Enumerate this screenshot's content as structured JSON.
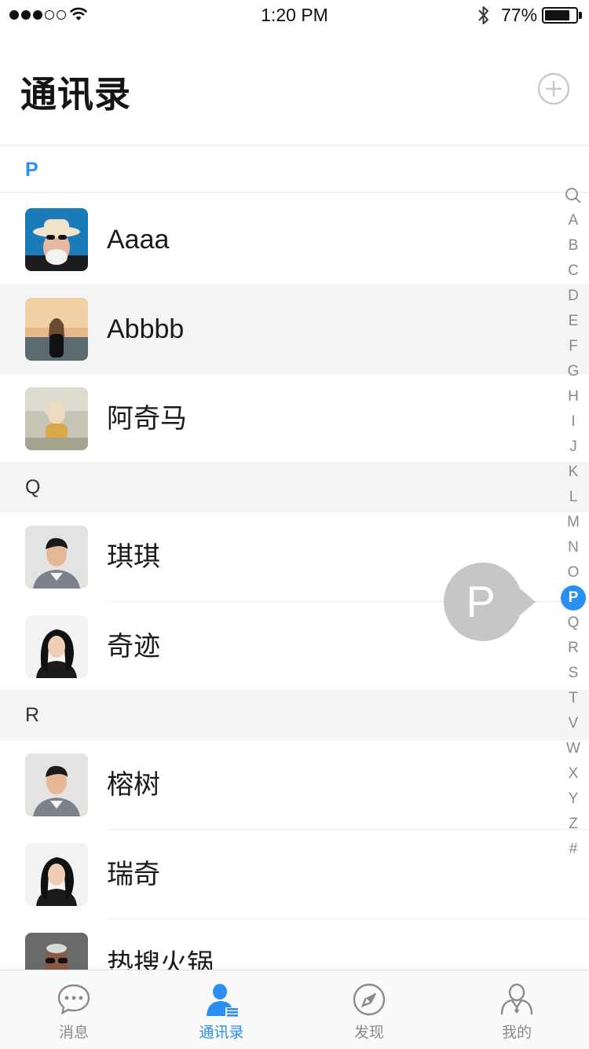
{
  "status_bar": {
    "time": "1:20 PM",
    "battery_percent": "77%",
    "signal_bars_filled": 3,
    "signal_bars_total": 5,
    "battery_level": 0.77
  },
  "header": {
    "title": "通讯录",
    "add_icon": "plus-circle-icon"
  },
  "sections": [
    {
      "letter": "P",
      "contacts": [
        "Aaaa",
        "Abbbb",
        "阿奇马"
      ]
    },
    {
      "letter": "Q",
      "contacts": [
        "琪琪",
        "奇迹"
      ]
    },
    {
      "letter": "R",
      "contacts": [
        "榕树",
        "瑞奇",
        "热搜火锅"
      ]
    }
  ],
  "highlighted_contact": "Abbbb",
  "index_bar": {
    "search_icon": "search-icon",
    "letters": [
      "A",
      "B",
      "C",
      "D",
      "E",
      "F",
      "G",
      "H",
      "I",
      "J",
      "K",
      "L",
      "M",
      "N",
      "O",
      "P",
      "Q",
      "R",
      "S",
      "T",
      "V",
      "W",
      "X",
      "Y",
      "Z",
      "#"
    ],
    "active": "P"
  },
  "index_bubble_letter": "P",
  "tab_bar": [
    {
      "label": "消息",
      "icon": "chat-bubble-icon",
      "active": false
    },
    {
      "label": "通讯录",
      "icon": "contacts-icon",
      "active": true
    },
    {
      "label": "发现",
      "icon": "compass-icon",
      "active": false
    },
    {
      "label": "我的",
      "icon": "person-icon",
      "active": false
    }
  ],
  "colors": {
    "accent": "#2a8ff0",
    "section_bg": "#f4f4f4",
    "text": "#1a1a1a",
    "muted": "#8a8a8a"
  }
}
